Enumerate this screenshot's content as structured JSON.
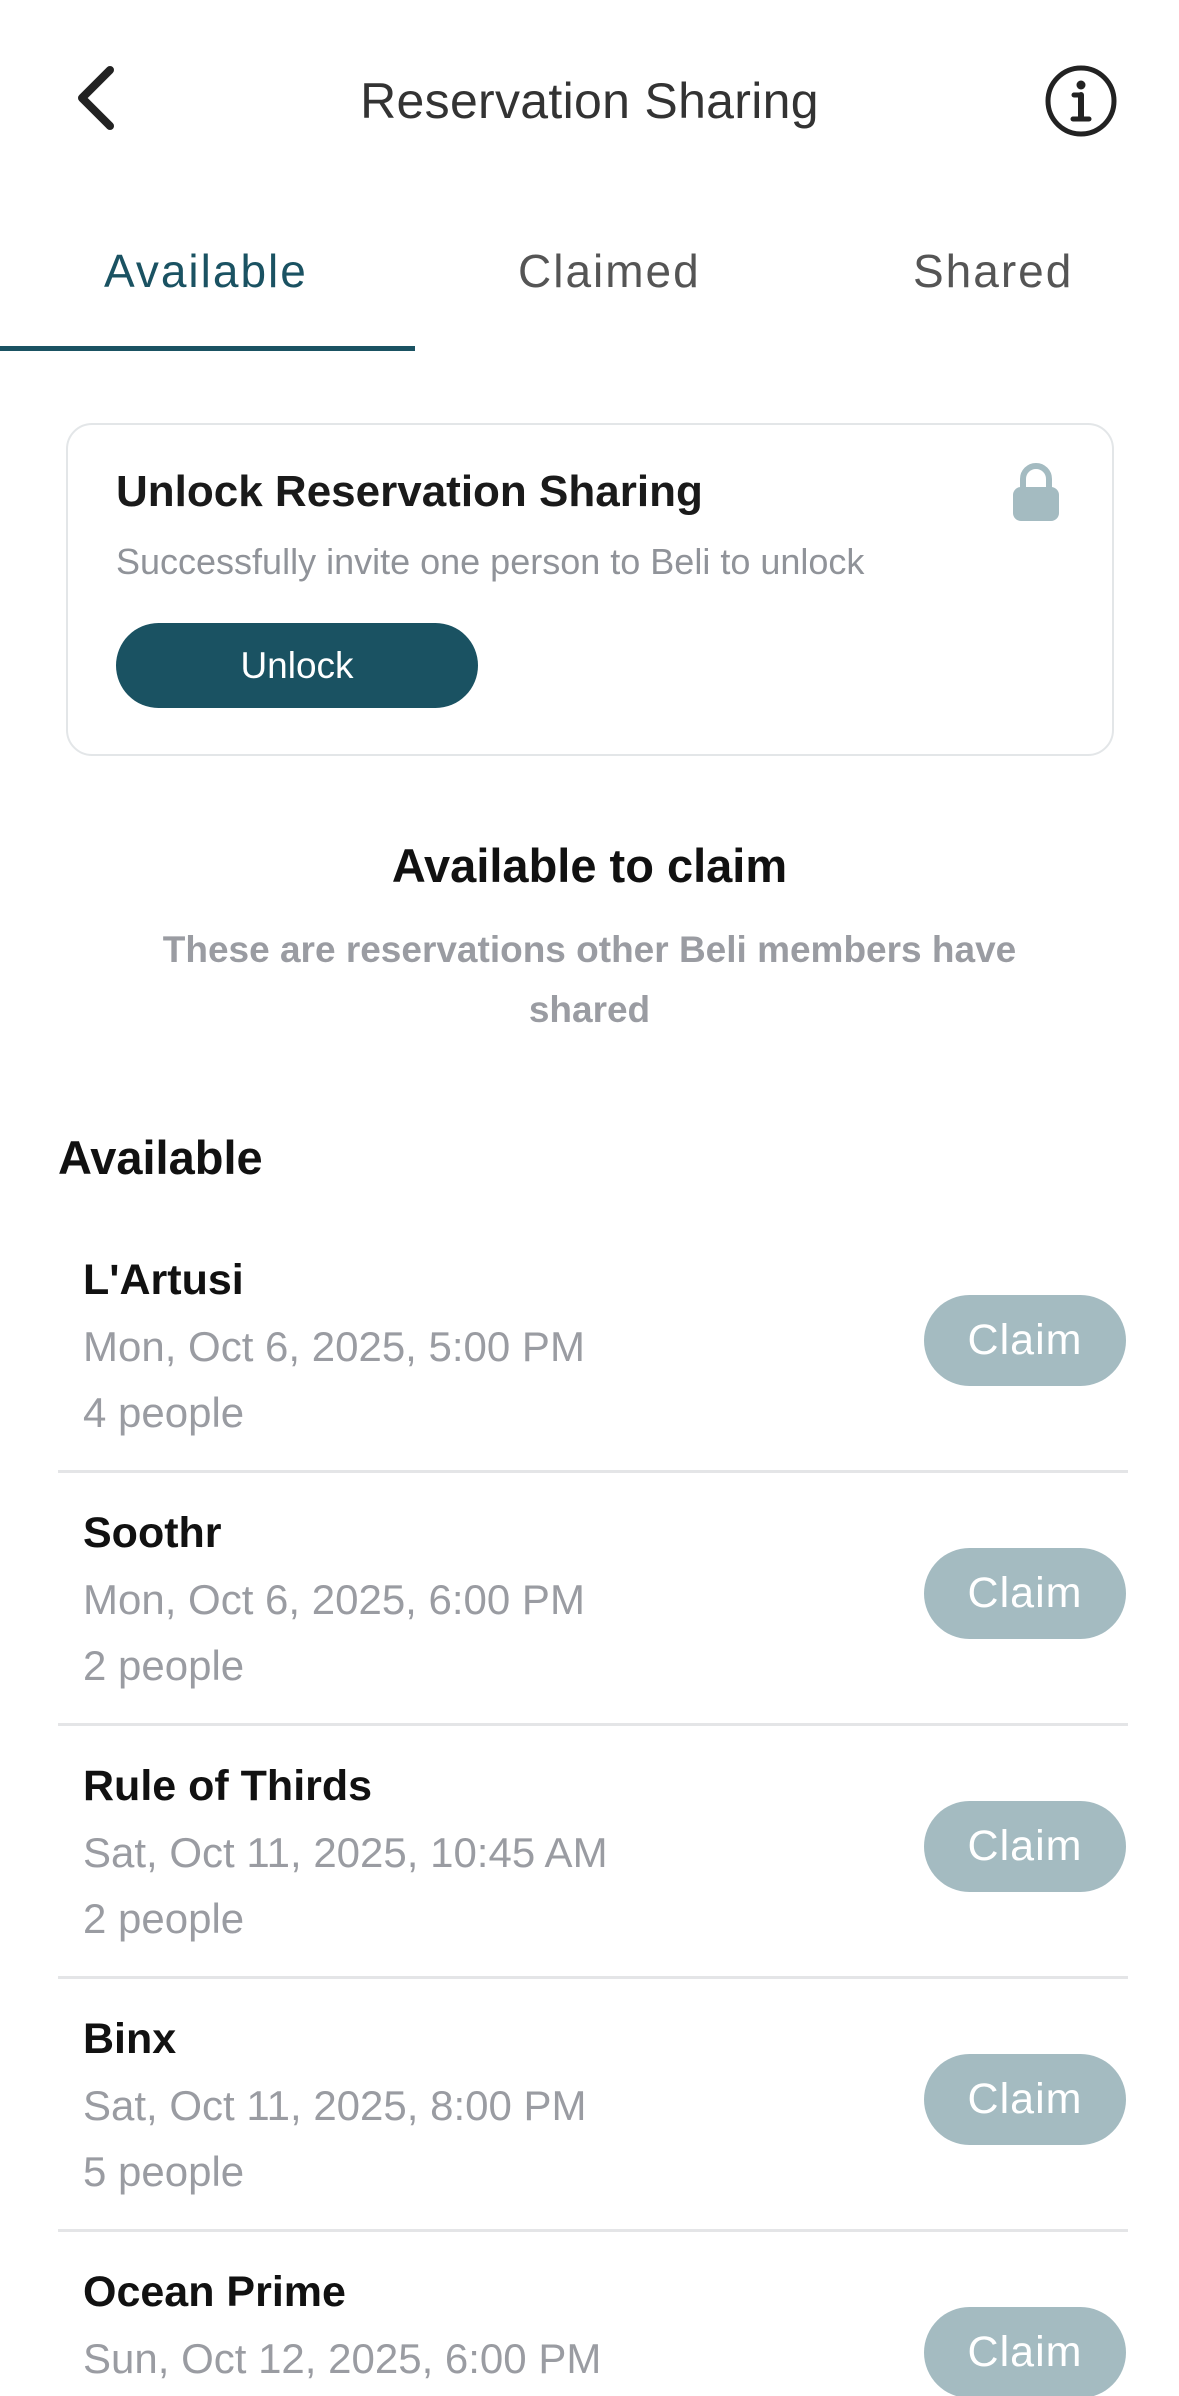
{
  "header": {
    "title": "Reservation Sharing",
    "back_icon": "chevron-left-icon",
    "info_icon": "info-icon"
  },
  "tabs": [
    {
      "label": "Available",
      "active": true
    },
    {
      "label": "Claimed",
      "active": false
    },
    {
      "label": "Shared",
      "active": false
    }
  ],
  "unlock_card": {
    "title": "Unlock Reservation Sharing",
    "subtitle": "Successfully invite one person to Beli to unlock",
    "button_label": "Unlock",
    "icon": "lock-icon"
  },
  "intro": {
    "heading": "Available to claim",
    "description": "These are reservations other Beli members have shared"
  },
  "list_heading": "Available",
  "reservations": [
    {
      "name": "L'Artusi",
      "datetime": "Mon, Oct 6, 2025, 5:00 PM",
      "party": "4 people",
      "action": "Claim"
    },
    {
      "name": "Soothr",
      "datetime": "Mon, Oct 6, 2025, 6:00 PM",
      "party": "2 people",
      "action": "Claim"
    },
    {
      "name": "Rule of Thirds",
      "datetime": "Sat, Oct 11, 2025, 10:45 AM",
      "party": "2 people",
      "action": "Claim"
    },
    {
      "name": "Binx",
      "datetime": "Sat, Oct 11, 2025, 8:00 PM",
      "party": "5 people",
      "action": "Claim"
    },
    {
      "name": "Ocean Prime",
      "datetime": "Sun, Oct 12, 2025, 6:00 PM",
      "party": "",
      "action": "Claim"
    }
  ],
  "colors": {
    "accent": "#1a5262",
    "claim_button": "#a4bbc1",
    "muted_text": "#9a9ca2",
    "divider": "#e4e5e7"
  }
}
